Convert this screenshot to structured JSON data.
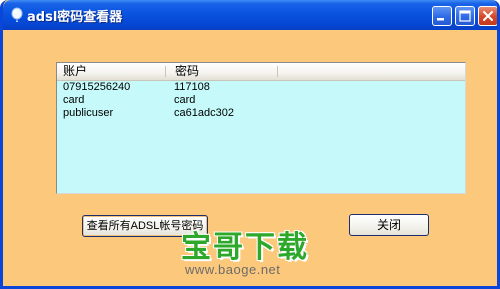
{
  "window": {
    "title": "adsl密码查看器"
  },
  "listview": {
    "columns": [
      "账户",
      "密码"
    ],
    "rows": [
      {
        "account": "07915256240",
        "password": "117108"
      },
      {
        "account": "card",
        "password": "card"
      },
      {
        "account": "publicuser",
        "password": "ca61adc302"
      }
    ]
  },
  "buttons": {
    "query_label": "查看所有ADSL帐号密码",
    "close_label": "关闭"
  },
  "watermark": {
    "brand": "宝哥下载",
    "url": "www.baoge.net"
  },
  "colors": {
    "titlebar": "#0549d6",
    "client_bg": "#fcc87c",
    "list_bg": "#c6fafa",
    "watermark_green": "#2ea82a"
  },
  "icons": {
    "app": "balloon-icon",
    "minimize": "minimize-icon",
    "maximize": "maximize-icon",
    "close": "close-icon"
  }
}
